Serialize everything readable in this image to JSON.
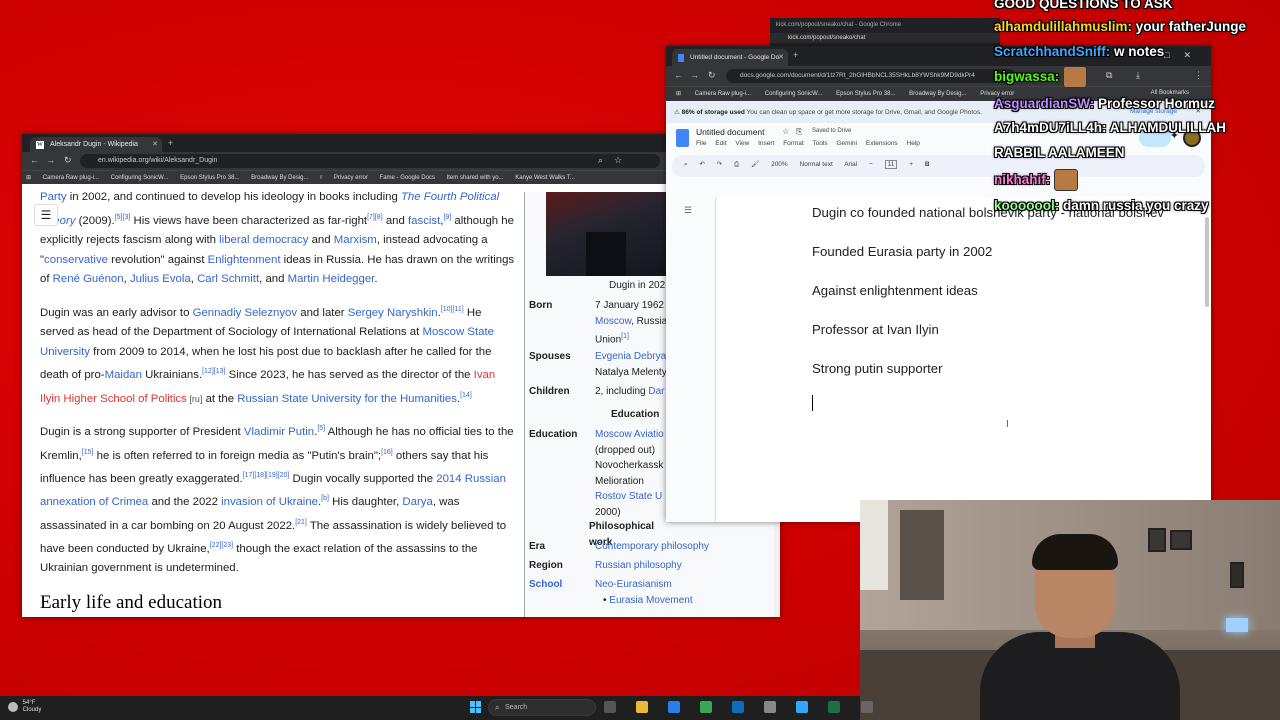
{
  "kick": {
    "title": "kick.com/popout/sneako/chat - Google Chrome",
    "url": "kick.com/popout/sneako/chat"
  },
  "wiki": {
    "tab_title": "Aleksandr Dugin - Wikipedia",
    "url": "en.wikipedia.org/wiki/Aleksandr_Dugin",
    "bookmarks": [
      "Camera Raw plug-i...",
      "Configuring SonicW...",
      "Epson Stylus Pro 38...",
      "Broadway By Desig...",
      "r",
      "Privacy error",
      "Fame - Google Docs",
      "Item shared with yo...",
      "Kanye West Walks T..."
    ],
    "para1": {
      "t1": "Party",
      "t2": " in 2002, and continued to develop his ideology in books including ",
      "t3": "The Fourth Political Theory",
      "t4": " (2009).",
      "t5": "[5][3]",
      "t6": " His views have been characterized as far-right",
      "t7": "[7][8]",
      "t8": " and ",
      "t9": "fascist",
      "t10": ",",
      "t11": "[9]",
      "t12": " although he explicitly rejects fascism along with ",
      "t13": "liberal democracy",
      "t14": " and ",
      "t15": "Marxism",
      "t16": ", instead advocating a \"",
      "t17": "conservative",
      "t18": " revolution\" against ",
      "t19": "Enlightenment",
      "t20": " ideas in Russia. He has drawn on the writings of ",
      "t21": "René Guénon",
      "t22": ", ",
      "t23": "Julius Evola",
      "t24": ", ",
      "t25": "Carl Schmitt",
      "t26": ", and ",
      "t27": "Martin Heidegger",
      "t28": "."
    },
    "para2": {
      "t1": "Dugin was an early advisor to ",
      "t2": "Gennadiy Seleznyov",
      "t3": " and later ",
      "t4": "Sergey Naryshkin",
      "t5": ".",
      "t6": "[10][11]",
      "t7": " He served as head of the Department of Sociology of International Relations at ",
      "t8": "Moscow State University",
      "t9": " from 2009 to 2014, when he lost his post due to backlash after he called for the death of pro-",
      "t10": "Maidan",
      "t11": " Ukrainians.",
      "t12": "[12][13]",
      "t13": " Since 2023, he has served as the director of the ",
      "t14": "Ivan Ilyin Higher School of Politics",
      "t15": " [ru]",
      "t16": " at the ",
      "t17": "Russian State University for the Humanities",
      "t18": ".",
      "t19": "[14]"
    },
    "para3": {
      "t1": "Dugin is a strong supporter of President ",
      "t2": "Vladimir Putin",
      "t3": ".",
      "t4": "[5]",
      "t5": " Although he has no official ties to the Kremlin,",
      "t6": "[15]",
      "t7": " he is often referred to in foreign media as \"Putin's brain\";",
      "t8": "[16]",
      "t9": " others say that his influence has been greatly exaggerated.",
      "t10": "[17][18][19][20]",
      "t11": " Dugin vocally supported the ",
      "t12": "2014 Russian annexation of Crimea",
      "t13": " and the 2022 ",
      "t14": "invasion of Ukraine",
      "t15": ".",
      "t16": "[b]",
      "t17": " His daughter, ",
      "t18": "Darya",
      "t19": ", was assassinated in a car bombing on 20 August 2022.",
      "t20": "[21]",
      "t21": " The assassination is widely believed to have been conducted by Ukraine,",
      "t22": "[22][23]",
      "t23": " though the exact relation of the assassins to the Ukrainian government is undetermined."
    },
    "section_heading": "Early life and education",
    "infobox": {
      "caption": "Dugin in 202",
      "born_label": "Born",
      "born_v1": "7 January 1962",
      "born_v2": "Moscow",
      "born_v3": ", Russia",
      "born_v4": "Union",
      "born_v5": "[1]",
      "spouses_label": "Spouses",
      "spouses_v1": "Evgenia Debrya",
      "spouses_v2": "Natalya Melenty",
      "children_label": "Children",
      "children_v1": "2, including ",
      "children_v2": "Dar",
      "education_header": "Education",
      "education_label": "Education",
      "edu_v1": "Moscow Aviatio",
      "edu_v2": "(dropped out)",
      "edu_v3": "Novocherkassk",
      "edu_v4": "Melioration",
      "edu_v5": "Rostov State U",
      "edu_v6": "2000)",
      "phil_header": "Philosophical work",
      "era_label": "Era",
      "era_v": "Contemporary philosophy",
      "region_label": "Region",
      "region_v": "Russian philosophy",
      "school_label": "School",
      "school_v1": "Neo-Eurasianism",
      "school_v2": "Eurasia Movement"
    }
  },
  "docs": {
    "tab_title": "Untitled document - Google Do",
    "url": "docs.google.com/document/d/1tz7Rt_2hGlHBbNCL35SHkLb8YWShk9MD9dkPr4",
    "bookmarks": [
      "Camera Raw plug-i...",
      "Configuring SonicW...",
      "Epson Stylus Pro 38...",
      "Broadway By Desig...",
      "Privacy error"
    ],
    "all_bookmarks": "All Bookmarks",
    "storage_pct": "86% of storage used",
    "storage_msg": " You can clean up space or get more storage for Drive, Gmail, and Google Photos.",
    "manage_storage": "Manage storage",
    "title": "Untitled document",
    "saved": "Saved to Drive",
    "menus": [
      "File",
      "Edit",
      "View",
      "Insert",
      "Format",
      "Tools",
      "Gemini",
      "Extensions",
      "Help"
    ],
    "zoom": "200%",
    "style": "Normal text",
    "font": "Arial",
    "font_size": "11",
    "lines": [
      "Dugin co founded national bolshevik party - national bolshev",
      "Founded Eurasia party in 2002",
      "Against enlightenment ideas",
      "Professor at Ivan Ilyin",
      "Strong putin supporter"
    ]
  },
  "chat": [
    {
      "user": "",
      "user_color": "#ffffff",
      "msg": "GOOD QUESTIONS TO ASK"
    },
    {
      "user": "alhamdulillahmuslim:",
      "user_color": "#ffd21f",
      "msg": " your fatherJunge"
    },
    {
      "user": "ScratchhandSniff:",
      "user_color": "#3ea6ff",
      "msg": " w notes"
    },
    {
      "user": "bigwassa:",
      "user_color": "#53fc18",
      "msg": ""
    },
    {
      "user": "AsguardianSW:",
      "user_color": "#b98cff",
      "msg": " Professor Hormuz"
    },
    {
      "user": "A7h4mDU7iLL4h:",
      "user_color": "#ffffff",
      "msg": " ALHAMDULILLAH"
    },
    {
      "user": "",
      "user_color": "#ffffff",
      "msg": "RABBIL AALAMEEN"
    },
    {
      "user": "nikhahif:",
      "user_color": "#ff7ad9",
      "msg": ""
    },
    {
      "user": "kooooool:",
      "user_color": "#8cff8c",
      "msg": " damn russia you crazy"
    }
  ],
  "taskbar": {
    "temp": "54°F",
    "condition": "Cloudy",
    "search_placeholder": "Search"
  },
  "colors": {
    "wiki_link": "#3366cc",
    "docs_blue": "#1a73e8",
    "desktop_red": "#d70000"
  }
}
